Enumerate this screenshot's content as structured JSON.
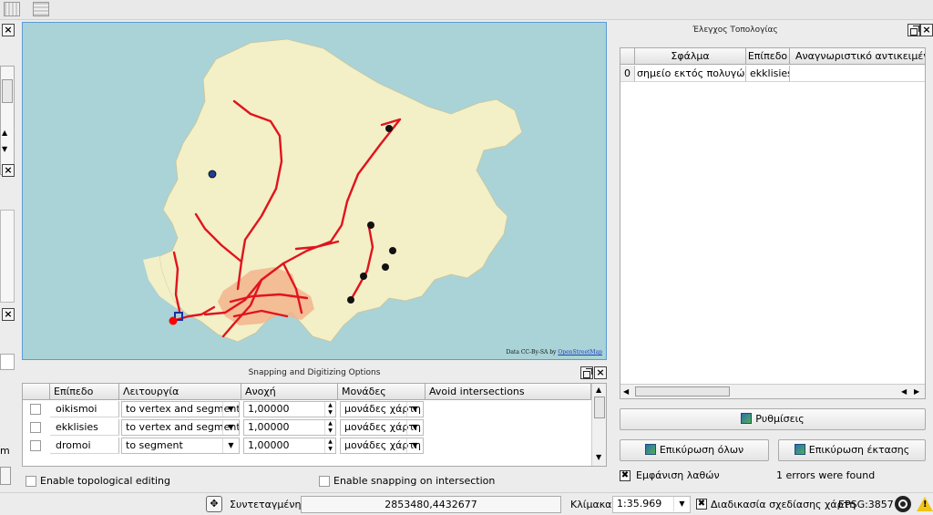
{
  "map": {
    "attribution": "Data CC-By-SA by ",
    "attribution_link": "OpenStreetMap",
    "colors": {
      "sea": "#a9d3d6",
      "land": "#f3efc7",
      "roads": "#e0141e",
      "urban": "#f2b48c"
    }
  },
  "topology": {
    "title": "Έλεγχος Τοπολογίας",
    "columns": [
      "Σφάλμα",
      "Επίπεδο",
      "Αναγνωριστικό αντικειμένου"
    ],
    "rows": [
      {
        "index": "0",
        "error": "σημείο εκτός πολυγώνου",
        "layer": "ekklisies",
        "id": ""
      }
    ],
    "settings_button": "Ρυθμίσεις",
    "validate_all_button": "Επικύρωση όλων",
    "validate_extent_button": "Επικύρωση έκτασης",
    "show_errors_label": "Εμφάνιση λαθών",
    "errors_found": "1 errors were found"
  },
  "snapping": {
    "title": "Snapping and Digitizing Options",
    "columns": [
      "Επίπεδο",
      "Λειτουργία",
      "Ανοχή",
      "Μονάδες",
      "Avoid intersections"
    ],
    "rows": [
      {
        "layer": "oikismoi",
        "mode": "to vertex and segment",
        "tolerance": "1,00000",
        "units": "μονάδες χάρτη"
      },
      {
        "layer": "ekklisies",
        "mode": "to vertex and segment",
        "tolerance": "1,00000",
        "units": "μονάδες χάρτη"
      },
      {
        "layer": "dromoi",
        "mode": "to segment",
        "tolerance": "1,00000",
        "units": "μονάδες χάρτη"
      }
    ],
    "topo_editing_label": "Enable topological editing",
    "snap_intersection_label": "Enable snapping on intersection"
  },
  "statusbar": {
    "coord_label": "Συντεταγμένη:",
    "coord_value": "2853480,4432677",
    "scale_label": "Κλίμακα",
    "scale_value": "1:35.969",
    "render_label": "Διαδικασία σχεδίασης χάρτη",
    "crs": "EPSG:3857"
  },
  "left_edge": {
    "cut_text": "m"
  }
}
